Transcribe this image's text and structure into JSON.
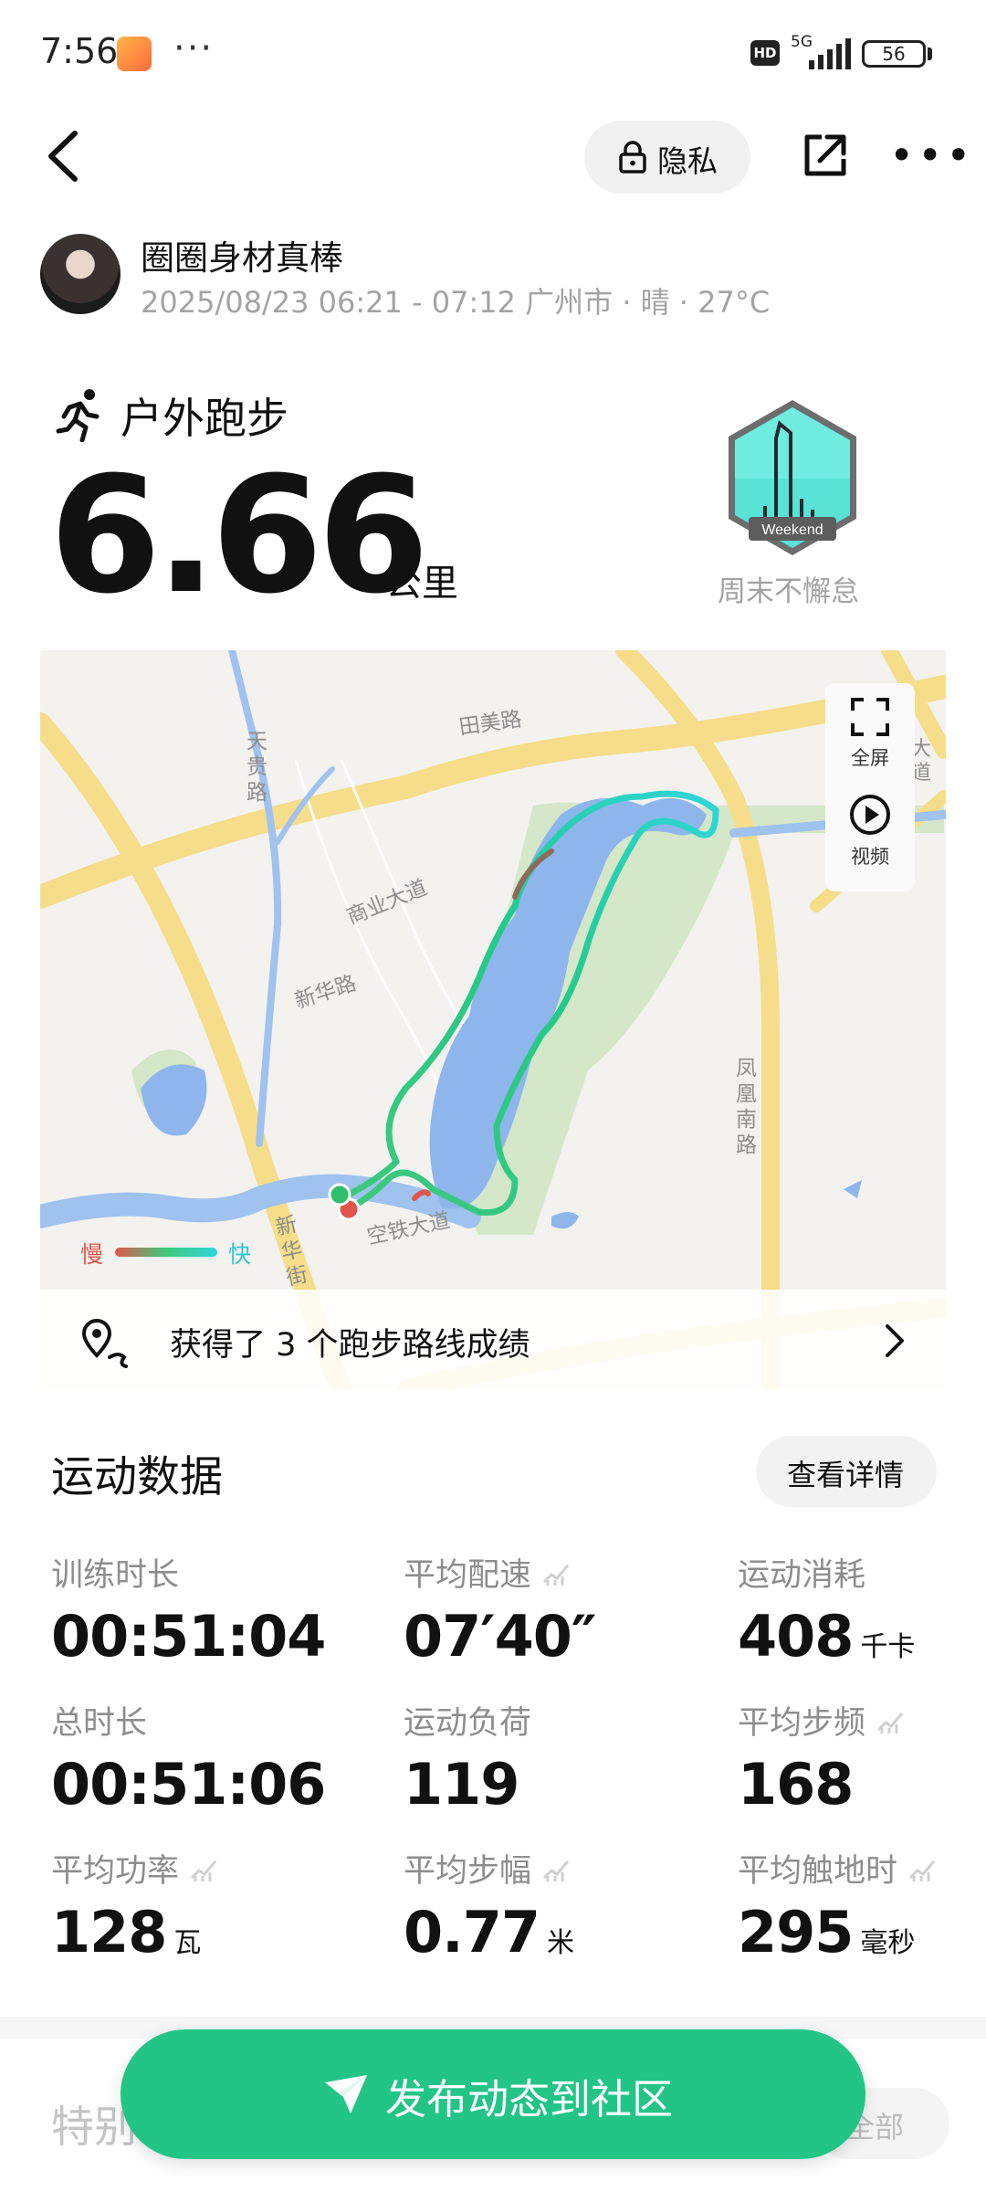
{
  "status_bar": {
    "time": "7:56",
    "dots": "···",
    "hd": "HD",
    "network": "5G",
    "battery": "56"
  },
  "toolbar": {
    "privacy_label": "隐私"
  },
  "user": {
    "name": "圈圈身材真棒",
    "meta": "2025/08/23 06:21 - 07:12 广州市 · 晴 · 27°C"
  },
  "activity": {
    "type": "户外跑步",
    "distance": "6.66",
    "distance_unit": "公里",
    "badge_text": "Weekend",
    "badge_label": "周末不懈怠"
  },
  "map": {
    "tools": {
      "fullscreen": "全屏",
      "video": "视频"
    },
    "legend": {
      "slow": "慢",
      "fast": "快"
    },
    "labels": {
      "tianmei": "田美路",
      "tiangui": "天贵路",
      "shangye": "商业大道",
      "xinhua_road": "新华路",
      "xinhua_street": "新华街",
      "fenghuang": "凤凰南路",
      "kongtie": "空铁大道",
      "edge_road": "大道"
    },
    "route_banner": "获得了 3 个跑步路线成绩",
    "colors": {
      "route_start": "#3ec97a",
      "route_end": "#2fd6d9",
      "slow": "#e0564c",
      "water": "#8fb6ec",
      "park": "#d4e7c8",
      "road": "#f5dd8a"
    }
  },
  "stats": {
    "title": "运动数据",
    "details_label": "查看详情",
    "items": [
      {
        "label": "训练时长",
        "value": "00:51:04",
        "unit": ""
      },
      {
        "label": "平均配速",
        "value": "07′40″",
        "unit": ""
      },
      {
        "label": "运动消耗",
        "value": "408",
        "unit": "千卡"
      },
      {
        "label": "总时长",
        "value": "00:51:06",
        "unit": ""
      },
      {
        "label": "运动负荷",
        "value": "119",
        "unit": ""
      },
      {
        "label": "平均步频",
        "value": "168",
        "unit": ""
      },
      {
        "label": "平均功率",
        "value": "128",
        "unit": "瓦"
      },
      {
        "label": "平均步幅",
        "value": "0.77",
        "unit": "米"
      },
      {
        "label": "平均触地时",
        "value": "295",
        "unit": "毫秒"
      }
    ]
  },
  "bottom": {
    "section_title": "特别",
    "all_label": "全部",
    "publish_label": "发布动态到社区"
  }
}
